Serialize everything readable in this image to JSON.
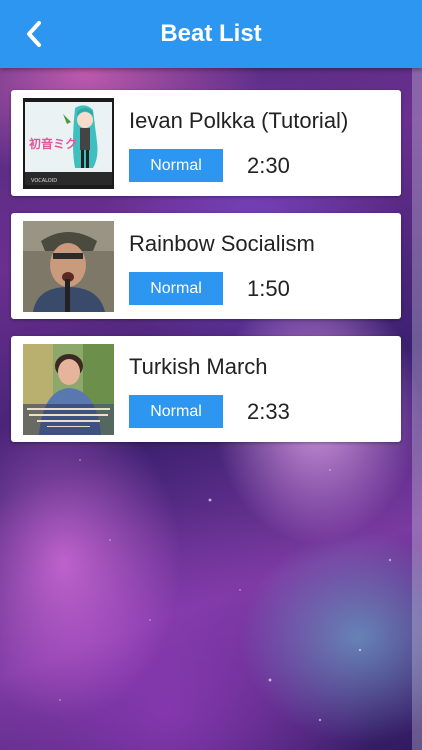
{
  "header": {
    "title": "Beat List",
    "back_icon": "chevron-left-icon",
    "color": "#2d96f0"
  },
  "songs": [
    {
      "title": "Ievan Polkka (Tutorial)",
      "difficulty": "Normal",
      "duration": "2:30",
      "thumbnail": "anime-singer-thumbnail"
    },
    {
      "title": "Rainbow Socialism",
      "difficulty": "Normal",
      "duration": "1:50",
      "thumbnail": "singer-portrait-thumbnail"
    },
    {
      "title": "Turkish March",
      "difficulty": "Normal",
      "duration": "2:33",
      "thumbnail": "piano-sonatas-album-thumbnail"
    }
  ]
}
